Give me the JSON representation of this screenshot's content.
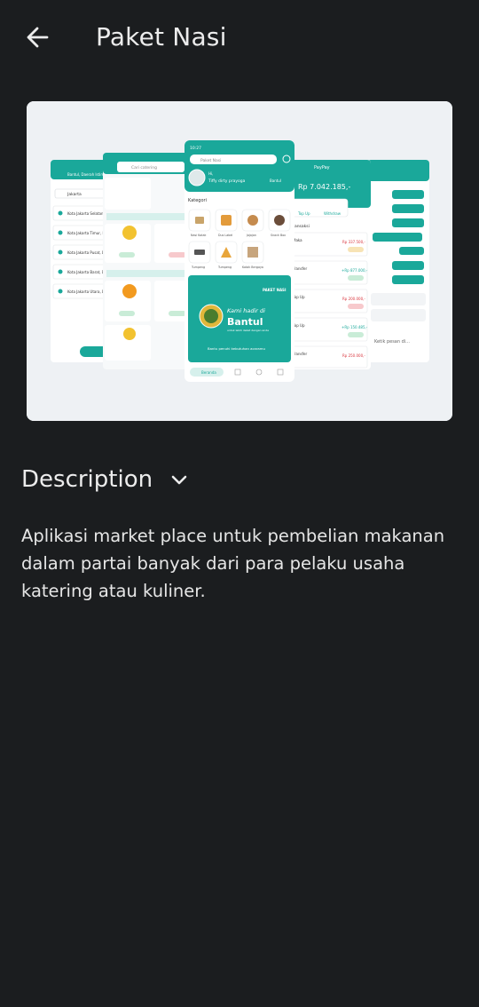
{
  "header": {
    "title": "Paket Nasi",
    "back_icon": "arrow-left-icon"
  },
  "preview": {
    "screen_left": {
      "title": "Bantul, Daerah Istimewa Y",
      "search_value": "Jakarta",
      "locations": [
        "Kota Jakarta Selatan,",
        "Kota Jakarta Timur, D",
        "Kota Jakarta Pusat, D",
        "Kota Jakarta Barat, D",
        "Kota Jakarta Utara, D"
      ]
    },
    "screen_catering": {
      "search_placeholder": "Cari catering"
    },
    "screen_home": {
      "status_time": "10:27",
      "search_placeholder": "Paket Nasi",
      "greeting": "Hi,",
      "user_name": "Tiffy dirty prayoga",
      "location": "Bantul",
      "section_title": "Kategori",
      "categories": [
        "Nasi Kotak",
        "Dus Label",
        "Jajajan",
        "Snack Box",
        "Tumpeng",
        "Tumpeng",
        "Kotak Bergaya"
      ],
      "banner_small": "PAKET NASI",
      "banner_line1": "Kami hadir di",
      "banner_line2": "Bantul",
      "banner_line3": "untuk lebih dekat dengan anda",
      "banner_cta": "Bantu penuhi kebutuhan acaramu",
      "nav_home": "Beranda"
    },
    "screen_wallet": {
      "title": "PayPay",
      "balance": "Rp 7.042.185,-",
      "action_topup": "Top Up",
      "action_withdraw": "Withdraw",
      "section": "Transaksi",
      "amount_1": "Rp 337.500,-",
      "amount_2": "+Rp 877.000,-",
      "amount_3": "Rp 200.000,-",
      "amount_4": "+Rp 150.485,-",
      "amount_5": "Rp 250.000,-",
      "label_1": "Maka",
      "label_2": "Transfer",
      "label_3": "Top Up",
      "label_4": "Top Up",
      "label_5": "Transfer"
    },
    "screen_chat": {
      "input_placeholder": "Ketik pesan di..."
    },
    "accent_color": "#1aa89a"
  },
  "description": {
    "title": "Description",
    "chevron_icon": "chevron-down-icon",
    "body": "Aplikasi market place untuk pembelian makanan dalam partai banyak dari para pelaku usaha katering atau kuliner."
  }
}
